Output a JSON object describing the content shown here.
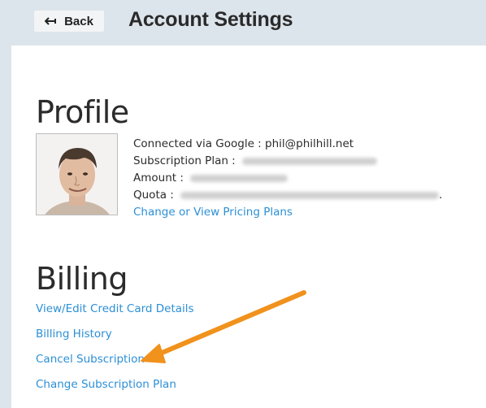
{
  "header": {
    "back_label": "Back",
    "title": "Account Settings"
  },
  "profile": {
    "heading": "Profile",
    "connected_label": "Connected via Google :",
    "connected_value": "phil@philhill.net",
    "subscription_label": "Subscription Plan :",
    "amount_label": "Amount :",
    "quota_label": "Quota :",
    "quota_trailing": ".",
    "pricing_link": "Change or View Pricing Plans"
  },
  "billing": {
    "heading": "Billing",
    "links": [
      "View/Edit Credit Card Details",
      "Billing History",
      "Cancel Subscription",
      "Change Subscription Plan"
    ]
  },
  "colors": {
    "link": "#2c8fd6",
    "arrow": "#f0921c",
    "header_bg": "#dde5ec"
  }
}
